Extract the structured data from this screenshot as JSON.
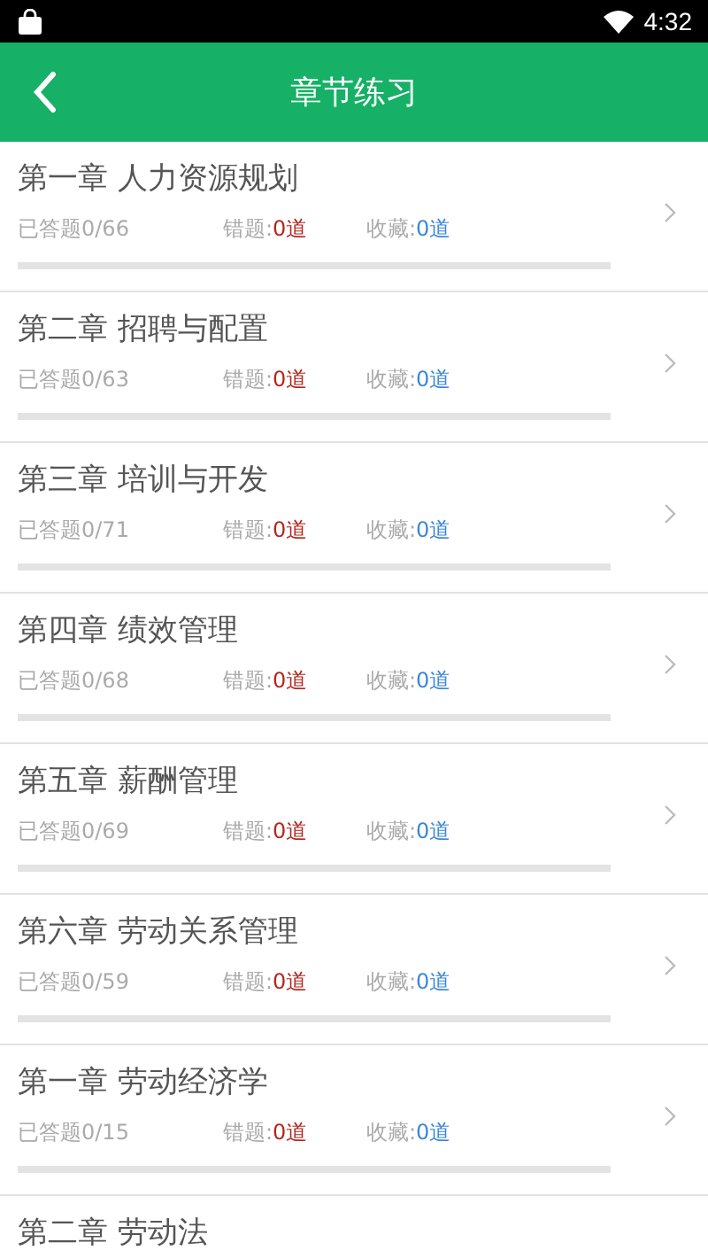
{
  "status_bar": {
    "time": "4:32"
  },
  "header": {
    "title": "章节练习"
  },
  "chapters": [
    {
      "title": "第一章 人力资源规划",
      "answered": "已答题0/66",
      "wrong_label": "错题:",
      "wrong_count": "0道",
      "fav_label": "收藏:",
      "fav_count": "0道"
    },
    {
      "title": "第二章 招聘与配置",
      "answered": "已答题0/63",
      "wrong_label": "错题:",
      "wrong_count": "0道",
      "fav_label": "收藏:",
      "fav_count": "0道"
    },
    {
      "title": "第三章 培训与开发",
      "answered": "已答题0/71",
      "wrong_label": "错题:",
      "wrong_count": "0道",
      "fav_label": "收藏:",
      "fav_count": "0道"
    },
    {
      "title": "第四章 绩效管理",
      "answered": "已答题0/68",
      "wrong_label": "错题:",
      "wrong_count": "0道",
      "fav_label": "收藏:",
      "fav_count": "0道"
    },
    {
      "title": "第五章 薪酬管理",
      "answered": "已答题0/69",
      "wrong_label": "错题:",
      "wrong_count": "0道",
      "fav_label": "收藏:",
      "fav_count": "0道"
    },
    {
      "title": "第六章 劳动关系管理",
      "answered": "已答题0/59",
      "wrong_label": "错题:",
      "wrong_count": "0道",
      "fav_label": "收藏:",
      "fav_count": "0道"
    },
    {
      "title": "第一章 劳动经济学",
      "answered": "已答题0/15",
      "wrong_label": "错题:",
      "wrong_count": "0道",
      "fav_label": "收藏:",
      "fav_count": "0道"
    },
    {
      "title": "第二章 劳动法"
    }
  ]
}
